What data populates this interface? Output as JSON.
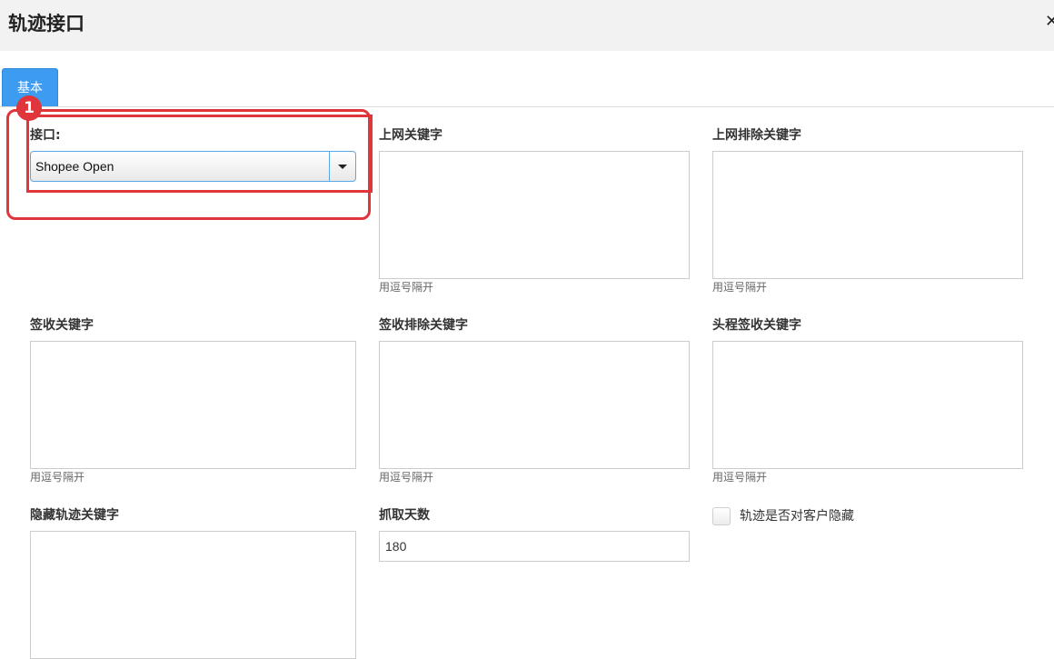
{
  "dialog": {
    "title": "轨迹接口",
    "close_label": "✕"
  },
  "tabs": [
    {
      "label": "基本"
    }
  ],
  "annotation": {
    "step_number": "1",
    "color": "#e0353a"
  },
  "form": {
    "interface": {
      "label": "接口:",
      "selected": "Shopee Open"
    },
    "online_keywords": {
      "label": "上网关键字",
      "value": "",
      "hint": "用逗号隔开"
    },
    "online_exclude_keywords": {
      "label": "上网排除关键字",
      "value": "",
      "hint": "用逗号隔开"
    },
    "signed_keywords": {
      "label": "签收关键字",
      "value": "",
      "hint": "用逗号隔开"
    },
    "signed_exclude_keywords": {
      "label": "签收排除关键字",
      "value": "",
      "hint": "用逗号隔开"
    },
    "first_leg_signed_keywords": {
      "label": "头程签收关键字",
      "value": "",
      "hint": "用逗号隔开"
    },
    "hide_track_keywords": {
      "label": "隐藏轨迹关键字",
      "value": ""
    },
    "fetch_days": {
      "label": "抓取天数",
      "value": "180"
    },
    "hide_from_customer": {
      "label": "轨迹是否对客户隐藏",
      "checked": false
    }
  },
  "colors": {
    "tab_active": "#3d9bf0",
    "header_bg": "#f2f2f2",
    "select_border": "#5aa7e8"
  }
}
